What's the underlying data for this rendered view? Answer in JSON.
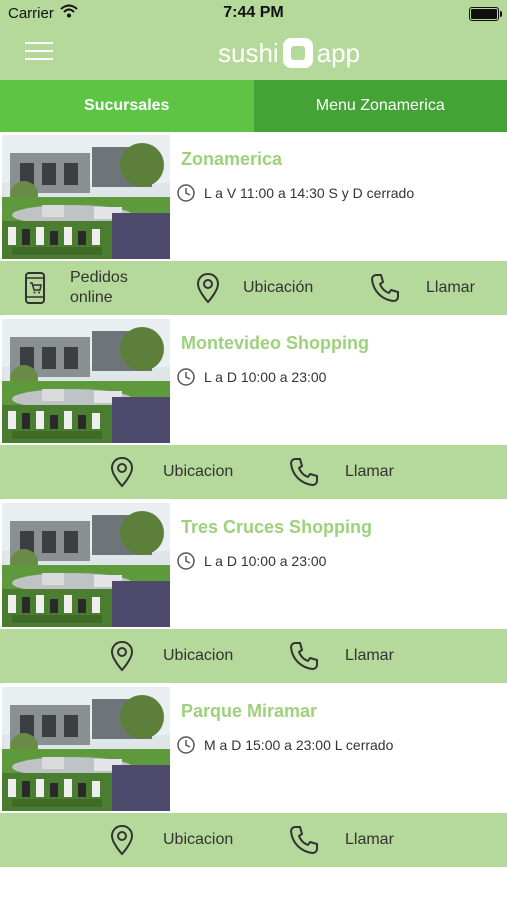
{
  "status_bar": {
    "carrier": "Carrier",
    "time": "7:44 PM"
  },
  "header": {
    "logo_left": "sushi",
    "logo_right": "app"
  },
  "tabs": [
    {
      "label": "Sucursales",
      "active": true
    },
    {
      "label": "Menu Zonamerica",
      "active": false
    }
  ],
  "branches": [
    {
      "name": "Zonamerica",
      "hours": "L a V 11:00 a 14:30 S y D cerrado",
      "order_label": "Pedidos online",
      "location_label": "Ubicación",
      "call_label": "Llamar"
    },
    {
      "name": "Montevideo Shopping",
      "hours": "L a D 10:00 a 23:00",
      "location_label": "Ubicacion",
      "call_label": "Llamar"
    },
    {
      "name": "Tres Cruces Shopping",
      "hours": "L a D 10:00 a 23:00",
      "location_label": "Ubicacion",
      "call_label": "Llamar"
    },
    {
      "name": "Parque Miramar",
      "hours": "M a D 15:00 a 23:00 L cerrado",
      "location_label": "Ubicacion",
      "call_label": "Llamar"
    }
  ],
  "colors": {
    "header": "#b5d99a",
    "tab_active": "#5ec444",
    "tab_inactive": "#43a335",
    "title": "#9ed17c"
  }
}
